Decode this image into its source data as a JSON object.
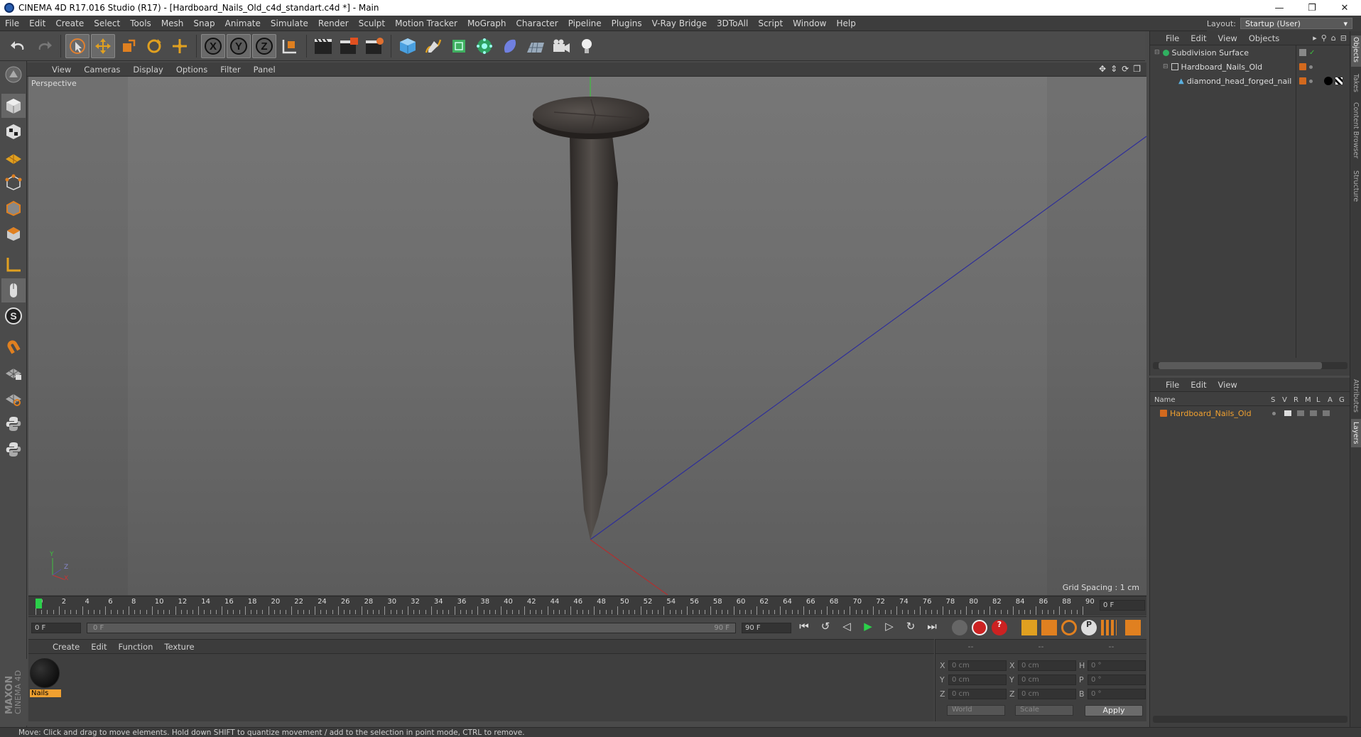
{
  "window": {
    "title": "CINEMA 4D R17.016 Studio (R17) - [Hardboard_Nails_Old_c4d_standart.c4d *] - Main",
    "minimize": "—",
    "restore": "❐",
    "close": "✕"
  },
  "menu": [
    "File",
    "Edit",
    "Create",
    "Select",
    "Tools",
    "Mesh",
    "Snap",
    "Animate",
    "Simulate",
    "Render",
    "Sculpt",
    "Motion Tracker",
    "MoGraph",
    "Character",
    "Pipeline",
    "Plugins",
    "V-Ray Bridge",
    "3DToAll",
    "Script",
    "Window",
    "Help"
  ],
  "layout": {
    "label": "Layout:",
    "value": "Startup (User)"
  },
  "viewport": {
    "menu": [
      "View",
      "Cameras",
      "Display",
      "Options",
      "Filter",
      "Panel"
    ],
    "label": "Perspective",
    "grid_spacing": "Grid Spacing : 1 cm",
    "axes": {
      "x": "X",
      "y": "Y",
      "z": "Z"
    }
  },
  "timeline": {
    "ticks": [
      "0",
      "2",
      "4",
      "6",
      "8",
      "10",
      "12",
      "14",
      "16",
      "18",
      "20",
      "22",
      "24",
      "26",
      "28",
      "30",
      "32",
      "34",
      "36",
      "38",
      "40",
      "42",
      "44",
      "46",
      "48",
      "50",
      "52",
      "54",
      "56",
      "58",
      "60",
      "62",
      "64",
      "66",
      "68",
      "70",
      "72",
      "74",
      "76",
      "78",
      "80",
      "82",
      "84",
      "86",
      "88",
      "90"
    ],
    "current_frame": "0 F"
  },
  "transport": {
    "start": "0 F",
    "range_start": "0 F",
    "range_end": "90 F",
    "end": "90 F"
  },
  "material_panel": {
    "menu": [
      "Create",
      "Edit",
      "Function",
      "Texture"
    ],
    "materials": [
      {
        "name": "Nails"
      }
    ],
    "brand_top": "MAXON",
    "brand_bottom": "CINEMA 4D"
  },
  "coord_panel": {
    "headers": [
      "--",
      "--",
      "--"
    ],
    "rows": [
      {
        "a_label": "X",
        "a_val": "0 cm",
        "b_label": "X",
        "b_val": "0 cm",
        "c_label": "H",
        "c_val": "0 °"
      },
      {
        "a_label": "Y",
        "a_val": "0 cm",
        "b_label": "Y",
        "b_val": "0 cm",
        "c_label": "P",
        "c_val": "0 °"
      },
      {
        "a_label": "Z",
        "a_val": "0 cm",
        "b_label": "Z",
        "b_val": "0 cm",
        "c_label": "B",
        "c_val": "0 °"
      }
    ],
    "mode1": "World",
    "mode2": "Scale",
    "apply": "Apply"
  },
  "object_manager": {
    "menu": [
      "File",
      "Edit",
      "View",
      "Objects"
    ],
    "objects": [
      {
        "name": "Subdivision Surface",
        "indent": 0
      },
      {
        "name": "Hardboard_Nails_Old",
        "indent": 1
      },
      {
        "name": "diamond_head_forged_nail",
        "indent": 2
      }
    ]
  },
  "layer_manager": {
    "menu": [
      "File",
      "Edit",
      "View"
    ],
    "columns": {
      "name": "Name",
      "flags": [
        "S",
        "V",
        "R",
        "M",
        "L",
        "A",
        "G"
      ]
    },
    "layers": [
      {
        "name": "Hardboard_Nails_Old"
      }
    ]
  },
  "right_tabs": [
    "Objects",
    "Takes",
    "Content Browser",
    "Structure",
    "Attributes",
    "Layers"
  ],
  "status": "Move: Click and drag to move elements. Hold down SHIFT to quantize movement / add to the selection in point mode, CTRL to remove.",
  "colors": {
    "accent": "#d2691e",
    "selected_layer": "#f0a030",
    "axis_y": "#3fbf3f",
    "axis_x": "#cc3333",
    "axis_z": "#3a3aaa"
  }
}
